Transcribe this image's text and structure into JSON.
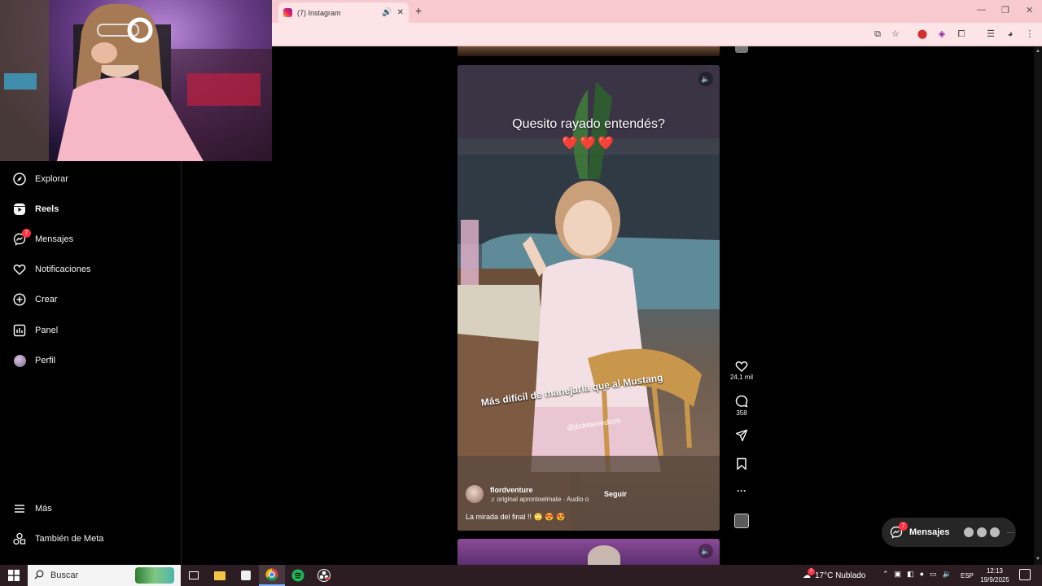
{
  "browser": {
    "tab_title": "(7) Instagram",
    "new_tab_symbol": "+"
  },
  "sidebar": {
    "items": [
      {
        "label": "Explorar",
        "icon": "compass-icon"
      },
      {
        "label": "Reels",
        "icon": "reels-icon"
      },
      {
        "label": "Mensajes",
        "icon": "messenger-icon",
        "badge": "7"
      },
      {
        "label": "Notificaciones",
        "icon": "heart-icon"
      },
      {
        "label": "Crear",
        "icon": "plus-square-icon"
      },
      {
        "label": "Panel",
        "icon": "chart-icon"
      },
      {
        "label": "Perfil",
        "icon": "avatar"
      }
    ],
    "more": {
      "label": "Más",
      "icon": "hamburger-icon"
    },
    "meta": {
      "label": "También de Meta",
      "icon": "meta-icon"
    }
  },
  "reel": {
    "caption_top": "Quesito rayado entendés?",
    "caption_hearts": "❤️❤️❤️",
    "caption_mid": "Más difícil de manejarla que al Mustang",
    "caption_handle": "@jbdebenedictis",
    "author": "flordventure",
    "audio": "♫ original  aprontoelmate · Audio o",
    "follow_label": "Seguir",
    "description": "La mirada del final !! 🙄 😍 😍",
    "likes": "24,1 mil",
    "comments": "358",
    "more_symbol": "···"
  },
  "messages_pill": {
    "label": "Mensajes",
    "badge": "7",
    "more_symbol": "···"
  },
  "taskbar": {
    "search_placeholder": "Buscar",
    "weather_badge": "2",
    "weather": "17°C  Nublado",
    "language": "ESP",
    "time": "12:13",
    "date": "19/9/2025"
  },
  "colors": {
    "ig_background": "#000000",
    "badge_red": "#ff3040",
    "browser_tab_pink": "#f8c9cf",
    "taskbar": "#2b1d22"
  }
}
